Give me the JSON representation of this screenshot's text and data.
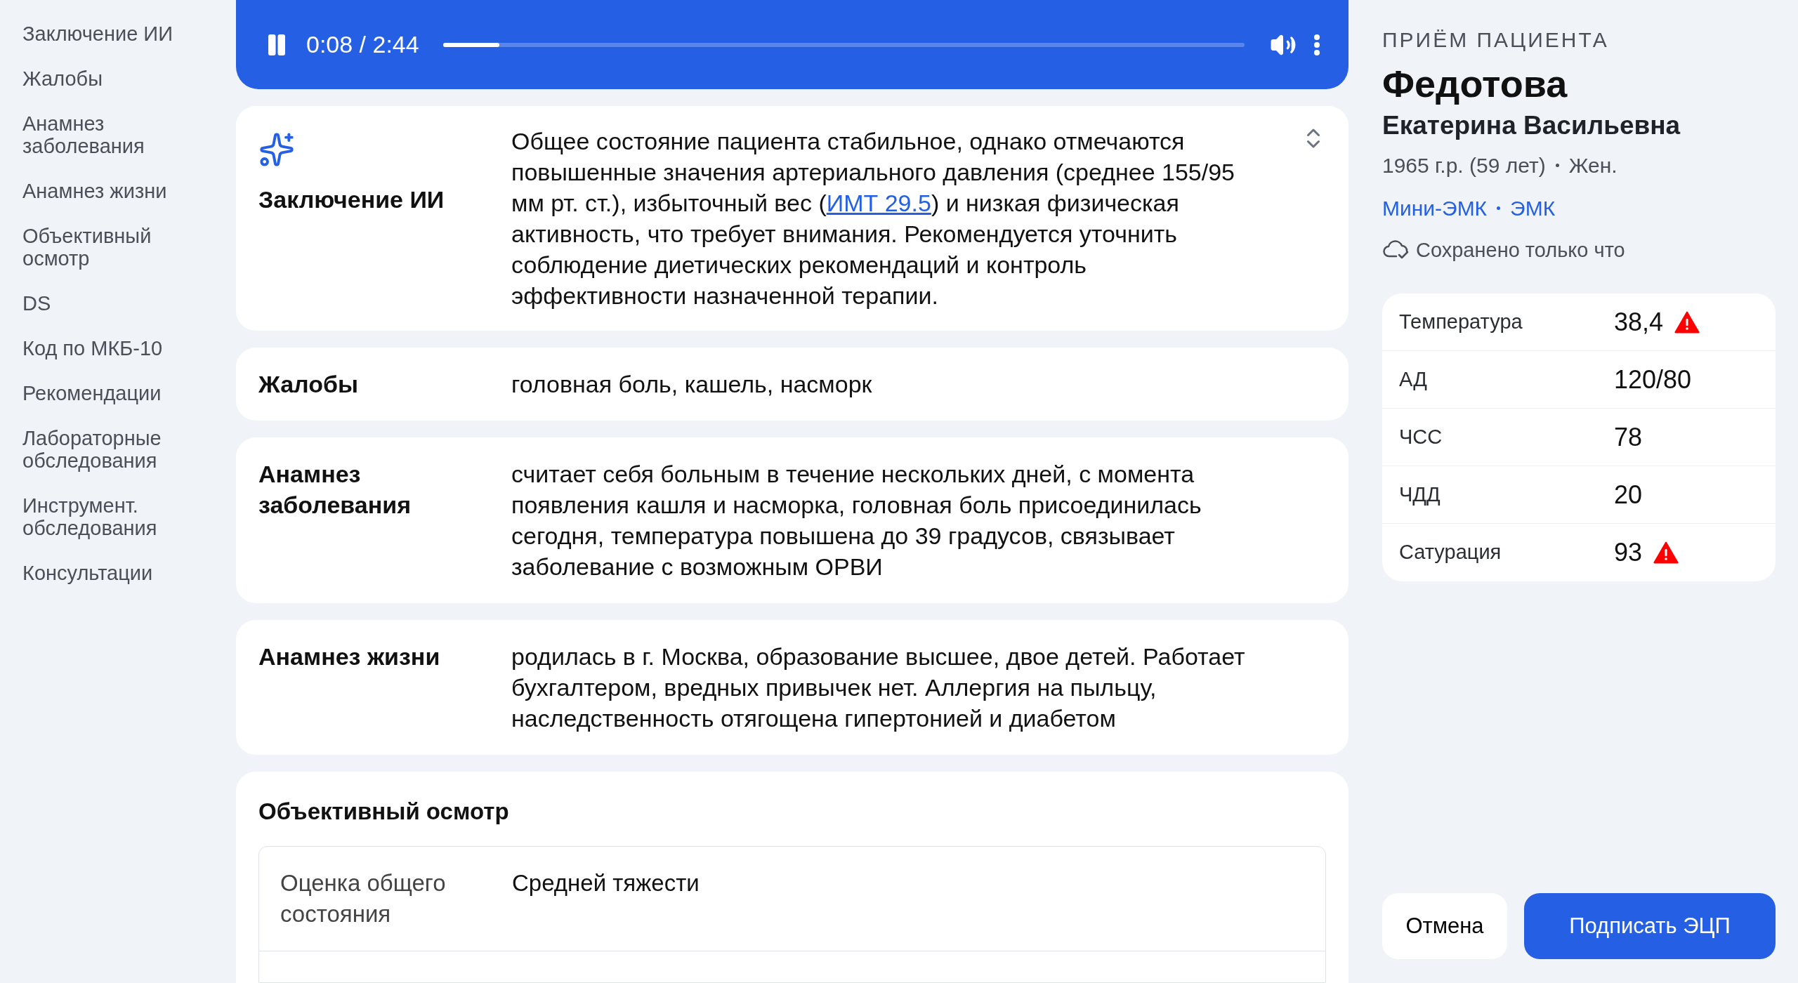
{
  "sidebar": {
    "items": [
      {
        "label": "Заключение ИИ"
      },
      {
        "label": "Жалобы"
      },
      {
        "label": "Анамнез заболевания"
      },
      {
        "label": "Анамнез жизни"
      },
      {
        "label": "Объективный осмотр"
      },
      {
        "label": "DS"
      },
      {
        "label": "Код по МКБ-10"
      },
      {
        "label": "Рекомендации"
      },
      {
        "label": "Лабораторные обследования"
      },
      {
        "label": "Инструмент. обследования"
      },
      {
        "label": "Консультации"
      }
    ]
  },
  "player": {
    "playing": true,
    "time": "0:08 / 2:44",
    "level": 0.07
  },
  "ai_summary": {
    "title": "Заключение ИИ",
    "before": "Общее состояние пациента стабильное, однако отмечаются повышенные значения артериального давления (среднее 155/95 мм рт. ст.), избыточный вес (",
    "link": "ИМТ 29.5",
    "after": ") и низкая физическая активность, что требует внимания. Рекомендуется уточнить соблюдение диетических рекомендаций и контроль эффективности назначенной терапии."
  },
  "sections": [
    {
      "title": "Жалобы",
      "text": "головная боль, кашель, насморк"
    },
    {
      "title": "Анамнез заболевания",
      "text": "считает себя больным в течение нескольких дней, с момента появления кашля и насморка, головная боль присоединилась сегодня, температура повышена до 39 градусов, связывает заболевание с возможным ОРВИ"
    },
    {
      "title": "Анамнез жизни",
      "text": "родилась в г. Москва, образование высшее, двое детей. Работает бухгалтером, вредных привычек нет. Аллергия на пыльцу, наследственность отягощена гипертонией и диабетом"
    }
  ],
  "exam": {
    "title": "Объективный осмотр",
    "rows": [
      {
        "label": "Оценка общего состояния",
        "value": "Средней тяжести"
      }
    ]
  },
  "patient": {
    "heading": "ПРИЁМ ПАЦИЕНТА",
    "surname": "Федотова",
    "given_names": "Екатерина Васильевна",
    "birth": "1965 г.р. (59 лет)",
    "sex": "Жен.",
    "links": [
      "Мини-ЭМК",
      "ЭМК"
    ],
    "saved": "Сохранено только что"
  },
  "vitals": [
    {
      "name": "Температура",
      "value": "38,4",
      "alert": true
    },
    {
      "name": "АД",
      "value": "120/80",
      "alert": false
    },
    {
      "name": "ЧСС",
      "value": "78",
      "alert": false
    },
    {
      "name": "ЧДД",
      "value": "20",
      "alert": false
    },
    {
      "name": "Сатурация",
      "value": "93",
      "alert": true
    }
  ],
  "buttons": [
    {
      "label": "Отмена",
      "kind": "secondary"
    },
    {
      "label": "Подписать ЭЦП",
      "kind": "primary"
    }
  ]
}
